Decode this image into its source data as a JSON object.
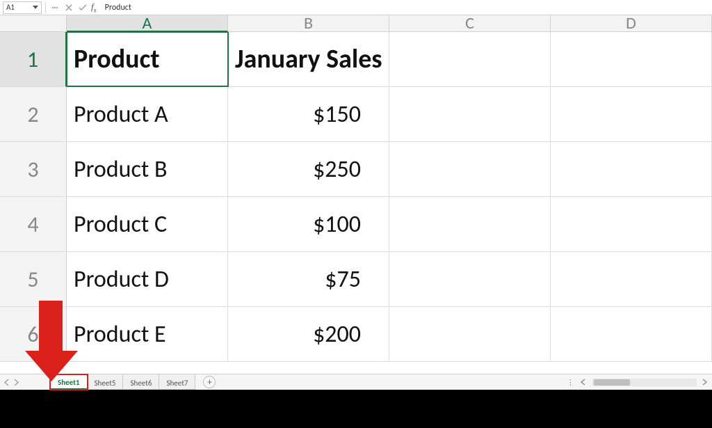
{
  "formula_bar": {
    "name_box": "A1",
    "value": "Product"
  },
  "columns": [
    "A",
    "B",
    "C",
    "D"
  ],
  "selected_col_index": 0,
  "row_numbers": [
    1,
    2,
    3,
    4,
    5,
    6
  ],
  "selected_row_index": 0,
  "selected_cell": {
    "row": 0,
    "col": 0
  },
  "cells": [
    [
      "Product",
      "January Sales",
      "",
      ""
    ],
    [
      "Product A",
      "$150",
      "",
      ""
    ],
    [
      "Product B",
      "$250",
      "",
      ""
    ],
    [
      "Product C",
      "$100",
      "",
      ""
    ],
    [
      "Product D",
      "$75",
      "",
      ""
    ],
    [
      "Product E",
      "$200",
      "",
      ""
    ]
  ],
  "numeric_cols": [
    1
  ],
  "sheet_tabs": [
    "Sheet1",
    "Sheet5",
    "Sheet6",
    "Sheet7"
  ],
  "active_sheet_index": 0,
  "new_sheet_label": "+"
}
